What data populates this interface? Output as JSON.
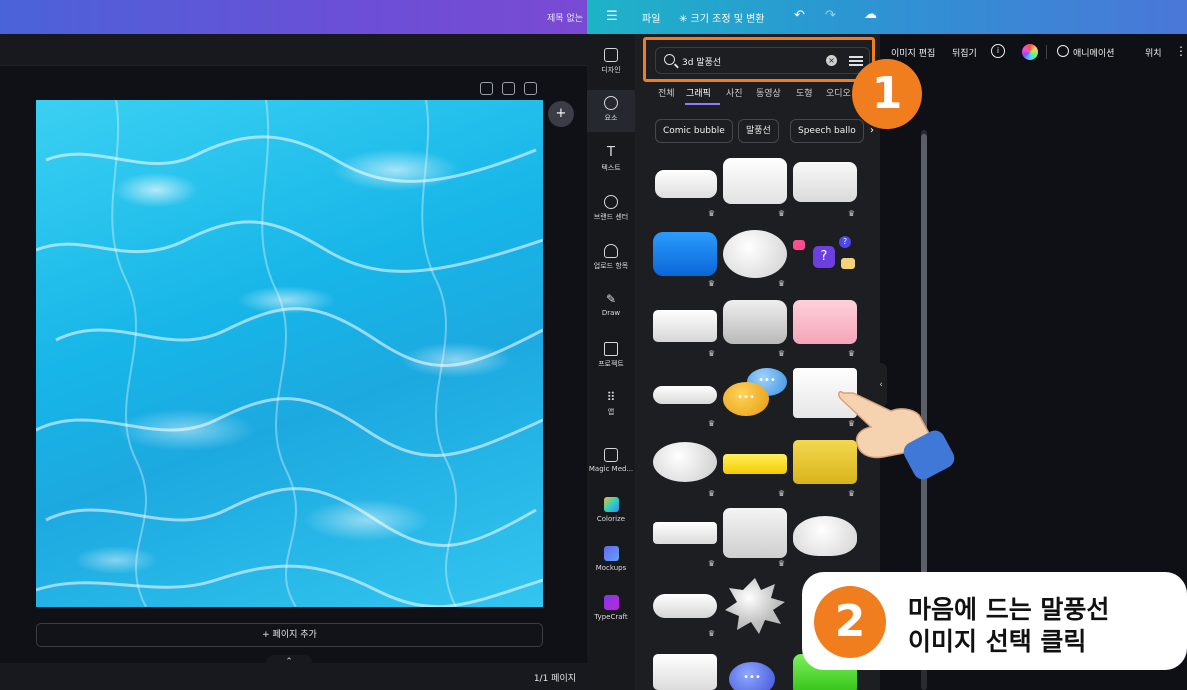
{
  "left": {
    "doc_title": "제목 없는",
    "add_page": "+ 페이지 추가",
    "page_count": "1/1 페이지",
    "expand_icon": "chevron-up-icon"
  },
  "topbar": {
    "menu_icon": "hamburger-icon",
    "file": "파일",
    "resize": "✳ 크기 조정 및 변환",
    "undo_icon": "undo-icon",
    "redo_icon": "redo-icon",
    "cloud_icon": "cloud-check-icon"
  },
  "toolbar": {
    "edit_image": "이미지 편집",
    "flip": "뒤집기",
    "info_icon": "info-icon",
    "animate": "애니메이션",
    "position": "위치"
  },
  "rail": [
    {
      "label": "디자인",
      "icon": "design-icon"
    },
    {
      "label": "요소",
      "icon": "elements-icon"
    },
    {
      "label": "텍스트",
      "icon": "text-icon"
    },
    {
      "label": "브랜드 센터",
      "icon": "brand-icon"
    },
    {
      "label": "업로드 항목",
      "icon": "upload-icon"
    },
    {
      "label": "Draw",
      "icon": "draw-icon"
    },
    {
      "label": "프로젝트",
      "icon": "folder-icon"
    },
    {
      "label": "앱",
      "icon": "apps-icon"
    },
    {
      "label": "Magic Med...",
      "icon": "magic-media-icon"
    },
    {
      "label": "Colorize",
      "icon": "colorize-icon"
    },
    {
      "label": "Mockups",
      "icon": "mockups-icon"
    },
    {
      "label": "TypeCraft",
      "icon": "typecraft-icon"
    }
  ],
  "search": {
    "value": "3d 말풍선",
    "clear_icon": "clear-icon",
    "filter_icon": "filter-icon"
  },
  "tabs": [
    "전체",
    "그래픽",
    "사진",
    "동영상",
    "도형",
    "오디오"
  ],
  "active_tab": "그래픽",
  "chips": [
    "Comic bubble",
    "말풍선",
    "Speech ballo"
  ],
  "colors": {
    "accent": "#f07d1e",
    "panel": "#1c1e22",
    "tab_underline": "#8b7dff"
  },
  "callouts": {
    "step1": "1",
    "step2": "2",
    "step2_line1": "마음에 드는 말풍선",
    "step2_line2": "이미지 선택 클릭"
  },
  "crown": "♛"
}
